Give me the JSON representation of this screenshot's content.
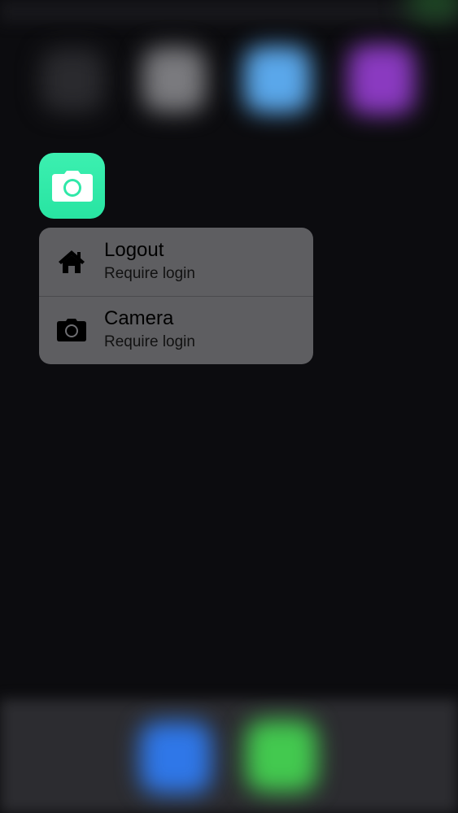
{
  "app_icon": {
    "name": "camera-icon",
    "color": "#2fe8a8"
  },
  "quick_actions": [
    {
      "title": "Logout",
      "subtitle": "Require login",
      "icon": "home-icon"
    },
    {
      "title": "Camera",
      "subtitle": "Require login",
      "icon": "camera-icon"
    }
  ],
  "colors": {
    "menu_background": "#6e6e72",
    "background": "#0c0c0f"
  }
}
